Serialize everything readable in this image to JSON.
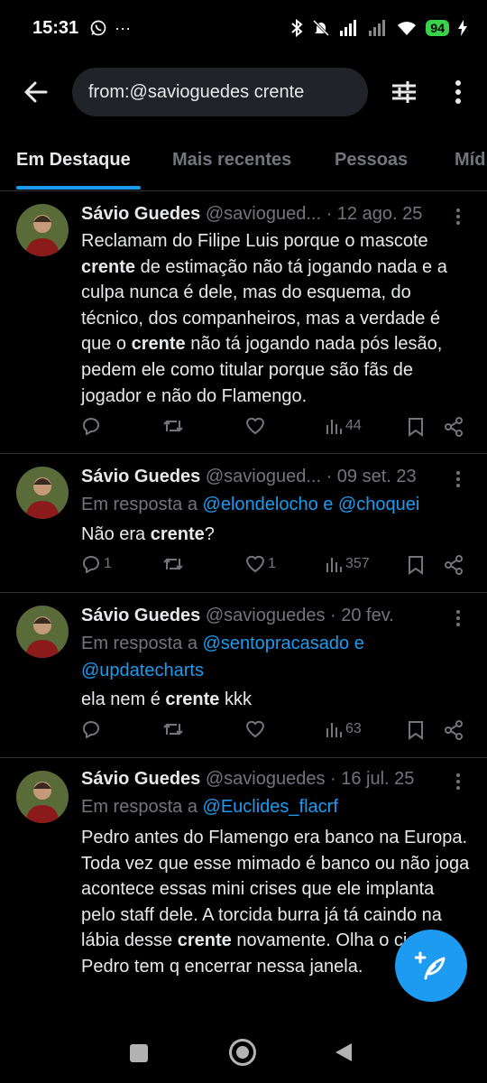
{
  "status_bar": {
    "time": "15:31",
    "battery": "94"
  },
  "search": {
    "query": "from:@savioguedes crente"
  },
  "tabs": [
    {
      "label": "Em Destaque"
    },
    {
      "label": "Mais recentes"
    },
    {
      "label": "Pessoas"
    },
    {
      "label": "Míd"
    }
  ],
  "tweets": [
    {
      "name": "Sávio Guedes",
      "handle": "@saviogued...",
      "date": "· 12 ago. 25",
      "body_parts": [
        "Reclamam do Filipe Luis porque o mascote ",
        "crente",
        " de estimação não tá jogando nada e a culpa nunca é dele, mas do esquema, do técnico, dos companheiros, mas a verdade é que o ",
        "crente",
        " não tá jogando nada pós lesão, pedem ele como titular porque são fãs de jogador e não do Flamengo."
      ],
      "replies": "",
      "retweets": "",
      "likes": "",
      "views": "44"
    },
    {
      "name": "Sávio Guedes",
      "handle": "@saviogued...",
      "date": "· 09 set. 23",
      "reply_prefix": "Em resposta a ",
      "reply_mentions": "@elondelocho e @choquei",
      "body_parts": [
        "Não era ",
        "crente",
        "?"
      ],
      "replies": "1",
      "retweets": "",
      "likes": "1",
      "views": "357"
    },
    {
      "name": "Sávio Guedes",
      "handle": "@savioguedes",
      "date": "· 20 fev.",
      "reply_prefix": "Em resposta a ",
      "reply_mentions": "@sentopracasado e @updatecharts",
      "body_parts": [
        "ela nem é ",
        "crente",
        " kkk"
      ],
      "replies": "",
      "retweets": "",
      "likes": "",
      "views": "63"
    },
    {
      "name": "Sávio Guedes",
      "handle": "@savioguedes",
      "date": "· 16 jul. 25",
      "reply_prefix": "Em resposta a ",
      "reply_mentions": "@Euclides_flacrf",
      "body_parts": [
        "Pedro antes do Flamengo era banco na Europa. Toda vez que esse mimado é banco ou não joga acontece essas mini crises que ele implanta pelo staff dele. A torcida burra já tá caindo na lábia desse ",
        "crente",
        " novamente. Olha o ciclo Pedro tem q encerrar nessa janela."
      ]
    }
  ],
  "icons": {
    "back": "arrow-left-icon",
    "filter": "sliders-icon",
    "more": "more-vertical-icon",
    "compose": "compose-tweet-icon"
  },
  "colors": {
    "accent": "#1d9bf0",
    "background": "#000000",
    "muted": "#71767b"
  }
}
